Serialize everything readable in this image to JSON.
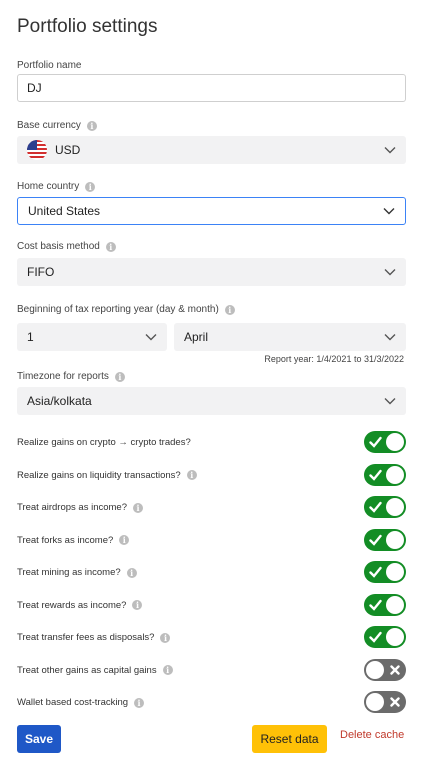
{
  "page": {
    "title": "Portfolio settings"
  },
  "portfolio_name": {
    "label": "Portfolio name",
    "value": "DJ"
  },
  "base_currency": {
    "label": "Base currency",
    "value": "USD",
    "flag_icon": "us-flag-icon"
  },
  "home_country": {
    "label": "Home country",
    "value": "United States"
  },
  "cost_basis": {
    "label": "Cost basis method",
    "value": "FIFO"
  },
  "tax_year": {
    "label": "Beginning of tax reporting year (day & month)",
    "day": "1",
    "month": "April",
    "report_note": "Report year: 1/4/2021 to 31/3/2022"
  },
  "timezone": {
    "label": "Timezone for reports",
    "value": "Asia/kolkata"
  },
  "toggles": [
    {
      "label": "Realize gains on crypto → crypto trades?",
      "on": true,
      "info": false
    },
    {
      "label": "Realize gains on liquidity transactions?",
      "on": true,
      "info": true
    },
    {
      "label": "Treat airdrops as income?",
      "on": true,
      "info": true
    },
    {
      "label": "Treat forks as income?",
      "on": true,
      "info": true
    },
    {
      "label": "Treat mining as income?",
      "on": true,
      "info": true
    },
    {
      "label": "Treat rewards as income?",
      "on": true,
      "info": true
    },
    {
      "label": "Treat transfer fees as disposals?",
      "on": true,
      "info": true
    },
    {
      "label": "Treat other gains as capital gains",
      "on": false,
      "info": true
    },
    {
      "label": "Wallet based cost-tracking",
      "on": false,
      "info": true
    }
  ],
  "actions": {
    "save_label": "Save",
    "reset_label": "Reset data",
    "delete_label": "Delete cache"
  },
  "colors": {
    "toggle_on": "#138d25",
    "toggle_off": "#6b6b6b",
    "save": "#1f58c7",
    "reset": "#ffc107",
    "delete": "#c0392b",
    "focus": "#3b82f6"
  }
}
